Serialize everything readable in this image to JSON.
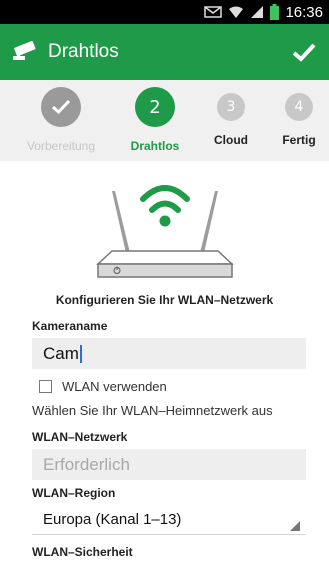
{
  "status_bar": {
    "time": "16:36"
  },
  "app_bar": {
    "title": "Drahtlos"
  },
  "stepper": {
    "steps": [
      {
        "number": "",
        "label": "Vorbereitung",
        "state": "done"
      },
      {
        "number": "2",
        "label": "Drahtlos",
        "state": "active"
      },
      {
        "number": "3",
        "label": "Cloud",
        "state": "todo"
      },
      {
        "number": "4",
        "label": "Fertig",
        "state": "todo"
      }
    ]
  },
  "headline": "Konfigurieren Sie Ihr WLAN–Netzwerk",
  "form": {
    "camera_name_label": "Kameraname",
    "camera_name_value": "Cam",
    "wlan_checkbox_label": "WLAN verwenden",
    "wlan_checkbox_checked": false,
    "hint": "Wählen Sie Ihr WLAN–Heimnetzwerk aus",
    "network_label": "WLAN–Netzwerk",
    "network_placeholder": "Erforderlich",
    "region_label": "WLAN–Region",
    "region_value": "Europa (Kanal 1–13)",
    "security_label": "WLAN–Sicherheit"
  },
  "colors": {
    "accent": "#1e9a48",
    "stepper_bg": "#f0f0f0"
  },
  "icons": {
    "app": "camera-icon",
    "confirm": "checkmark-icon",
    "status": [
      "notification-icon",
      "wifi-icon",
      "signal-icon",
      "battery-icon"
    ]
  }
}
